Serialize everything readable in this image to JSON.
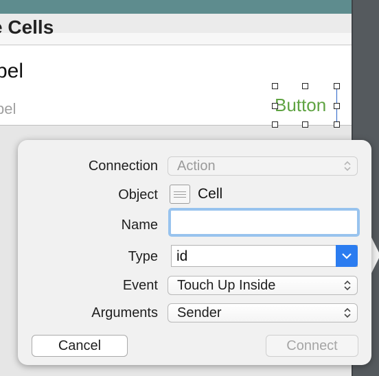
{
  "storyboard": {
    "section_title": "e Cells",
    "cell_title": "bel",
    "cell_subtitle": "bel",
    "button_text": "Button"
  },
  "popover": {
    "connection_label": "Connection",
    "connection_value": "Action",
    "object_label": "Object",
    "object_value": "Cell",
    "object_icon": "table-cell-icon",
    "name_label": "Name",
    "name_value": "",
    "type_label": "Type",
    "type_value": "id",
    "event_label": "Event",
    "event_value": "Touch Up Inside",
    "arguments_label": "Arguments",
    "arguments_value": "Sender",
    "cancel_label": "Cancel",
    "connect_label": "Connect"
  },
  "colors": {
    "accent": "#2b7cf0",
    "focus_ring": "#98c3ee",
    "button_tint": "#5fa342",
    "header_bar": "#5e8c8e"
  }
}
